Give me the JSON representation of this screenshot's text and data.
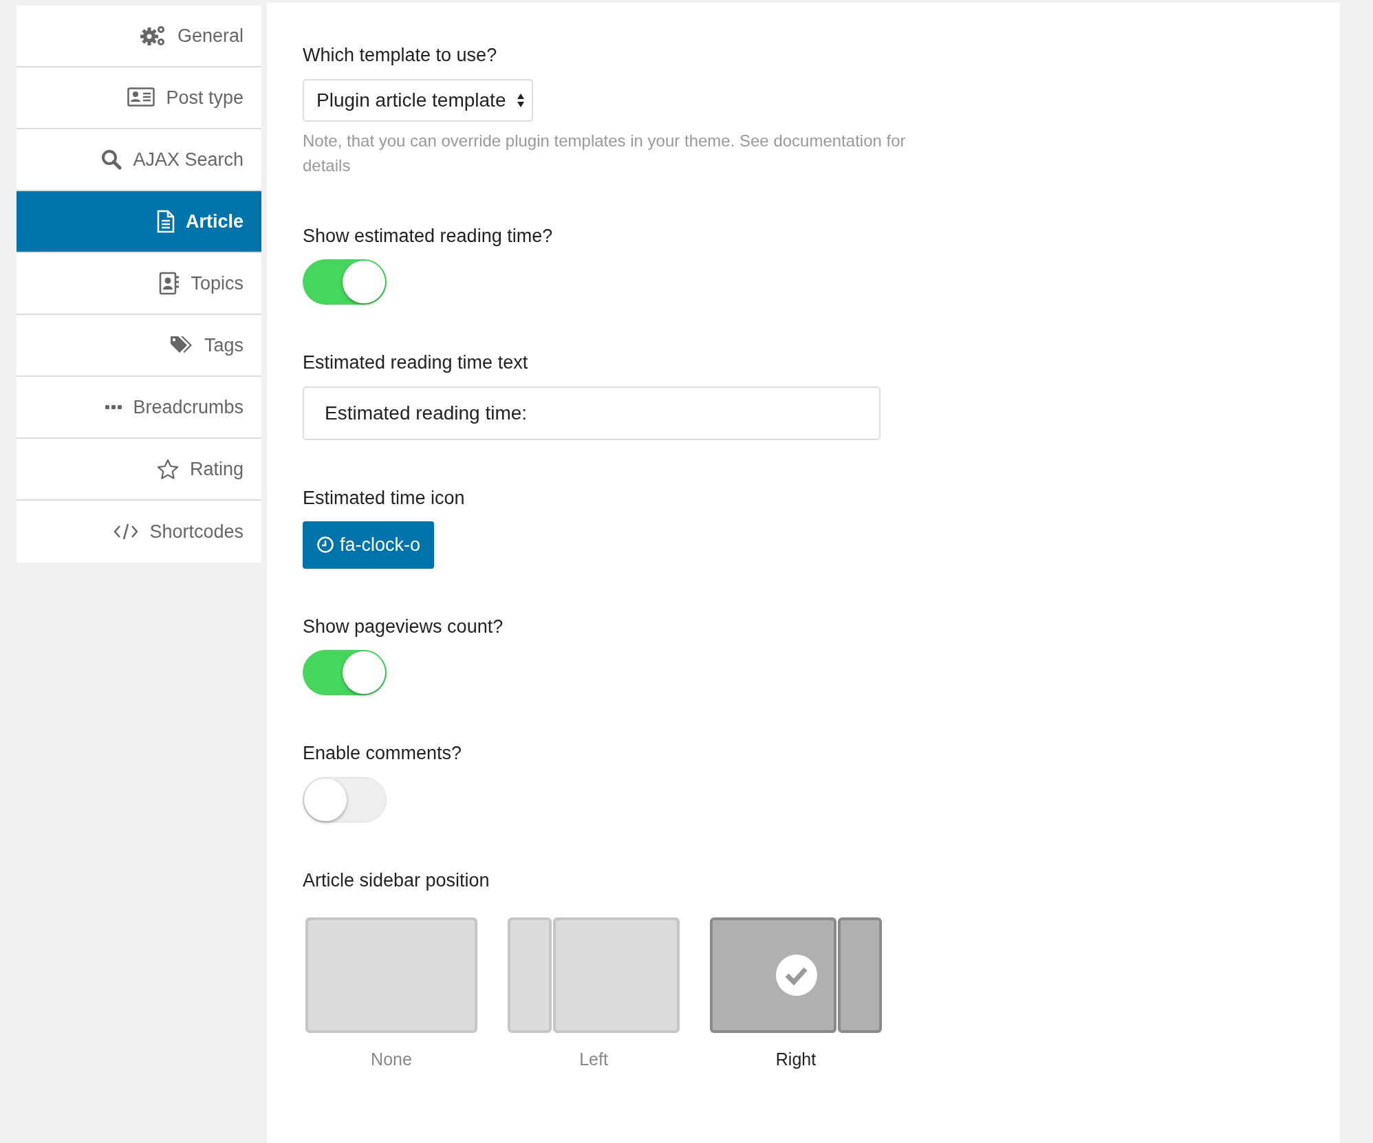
{
  "sidebar": {
    "items": [
      {
        "label": "General",
        "selected": false
      },
      {
        "label": "Post type",
        "selected": false
      },
      {
        "label": "AJAX Search",
        "selected": false
      },
      {
        "label": "Article",
        "selected": true
      },
      {
        "label": "Topics",
        "selected": false
      },
      {
        "label": "Tags",
        "selected": false
      },
      {
        "label": "Breadcrumbs",
        "selected": false
      },
      {
        "label": "Rating",
        "selected": false
      },
      {
        "label": "Shortcodes",
        "selected": false
      }
    ]
  },
  "fields": [
    {
      "kind": "select",
      "label": "Which template to use?",
      "value": "Plugin article template",
      "note": "Note, that you can override plugin templates in your theme. See documentation for details"
    },
    {
      "kind": "toggle",
      "label": "Show estimated reading time?",
      "on": true
    },
    {
      "kind": "text",
      "label": "Estimated reading time text",
      "value": "Estimated reading time:"
    },
    {
      "kind": "icon_button",
      "label": "Estimated time icon",
      "value": "fa-clock-o"
    },
    {
      "kind": "toggle",
      "label": "Show pageviews count?",
      "on": true
    },
    {
      "kind": "toggle",
      "label": "Enable comments?",
      "on": false
    },
    {
      "kind": "layout_picker",
      "label": "Article sidebar position",
      "options": [
        {
          "kind": "none",
          "label": "None",
          "selected": false
        },
        {
          "kind": "left",
          "label": "Left",
          "selected": false
        },
        {
          "kind": "right",
          "label": "Right",
          "selected": true
        }
      ]
    }
  ]
}
